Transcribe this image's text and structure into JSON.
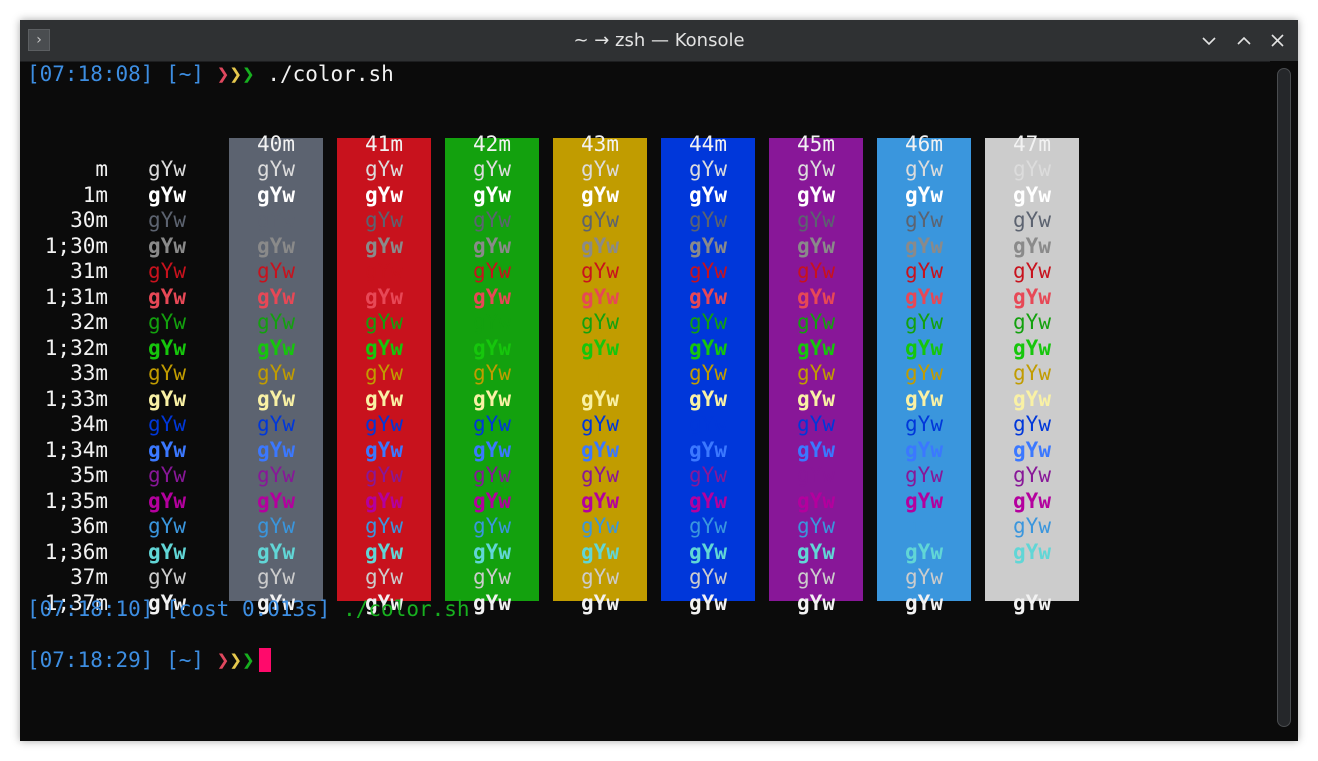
{
  "window": {
    "title": "~ → zsh — Konsole",
    "app_icon": "terminal-prompt-icon",
    "buttons": [
      "minimize-icon",
      "maximize-icon",
      "close-icon"
    ]
  },
  "terminal": {
    "prompt1": {
      "time": "[07:18:08]",
      "dir": "[~]",
      "command": "./color.sh"
    },
    "status_line": {
      "time": "[07:18:10]",
      "cost": "[cost 0.013s]",
      "command": "./color.sh"
    },
    "prompt2": {
      "time": "[07:18:29]",
      "dir": "[~]"
    },
    "prompt_arrows": [
      "❯",
      "❯",
      "❯"
    ],
    "prompt_arrow_colors": [
      "#e0485e",
      "#e6c84d",
      "#17b01f"
    ],
    "prompt_color": "#3d8ee2",
    "cursor_color": "#ff0a6b"
  },
  "color_table": {
    "sample_text": "gYw",
    "bg_headers": [
      "40m",
      "41m",
      "42m",
      "43m",
      "44m",
      "45m",
      "46m",
      "47m"
    ],
    "bg_colors": [
      "#5c6370",
      "#c8121d",
      "#13a10e",
      "#c19c00",
      "#0037da",
      "#881798",
      "#3a96dd",
      "#cccccc"
    ],
    "rows": [
      {
        "label": "m",
        "fg": "#dcdcdc",
        "bold": false
      },
      {
        "label": "1m",
        "fg": "#ffffff",
        "bold": true
      },
      {
        "label": "30m",
        "fg": "#5c6370",
        "bold": false
      },
      {
        "label": "1;30m",
        "fg": "#8a8a8a",
        "bold": true
      },
      {
        "label": "31m",
        "fg": "#c8121d",
        "bold": false
      },
      {
        "label": "1;31m",
        "fg": "#e74856",
        "bold": true
      },
      {
        "label": "32m",
        "fg": "#13a10e",
        "bold": false
      },
      {
        "label": "1;32m",
        "fg": "#16c60c",
        "bold": true
      },
      {
        "label": "33m",
        "fg": "#c19c00",
        "bold": false
      },
      {
        "label": "1;33m",
        "fg": "#f9f1a5",
        "bold": true
      },
      {
        "label": "34m",
        "fg": "#0037da",
        "bold": false
      },
      {
        "label": "1;34m",
        "fg": "#3b78ff",
        "bold": true
      },
      {
        "label": "35m",
        "fg": "#881798",
        "bold": false
      },
      {
        "label": "1;35m",
        "fg": "#b4009e",
        "bold": true
      },
      {
        "label": "36m",
        "fg": "#3a96dd",
        "bold": false
      },
      {
        "label": "1;36m",
        "fg": "#61d6d6",
        "bold": true
      },
      {
        "label": "37m",
        "fg": "#cccccc",
        "bold": false
      },
      {
        "label": "1;37m",
        "fg": "#f2f2f2",
        "bold": true
      }
    ]
  }
}
